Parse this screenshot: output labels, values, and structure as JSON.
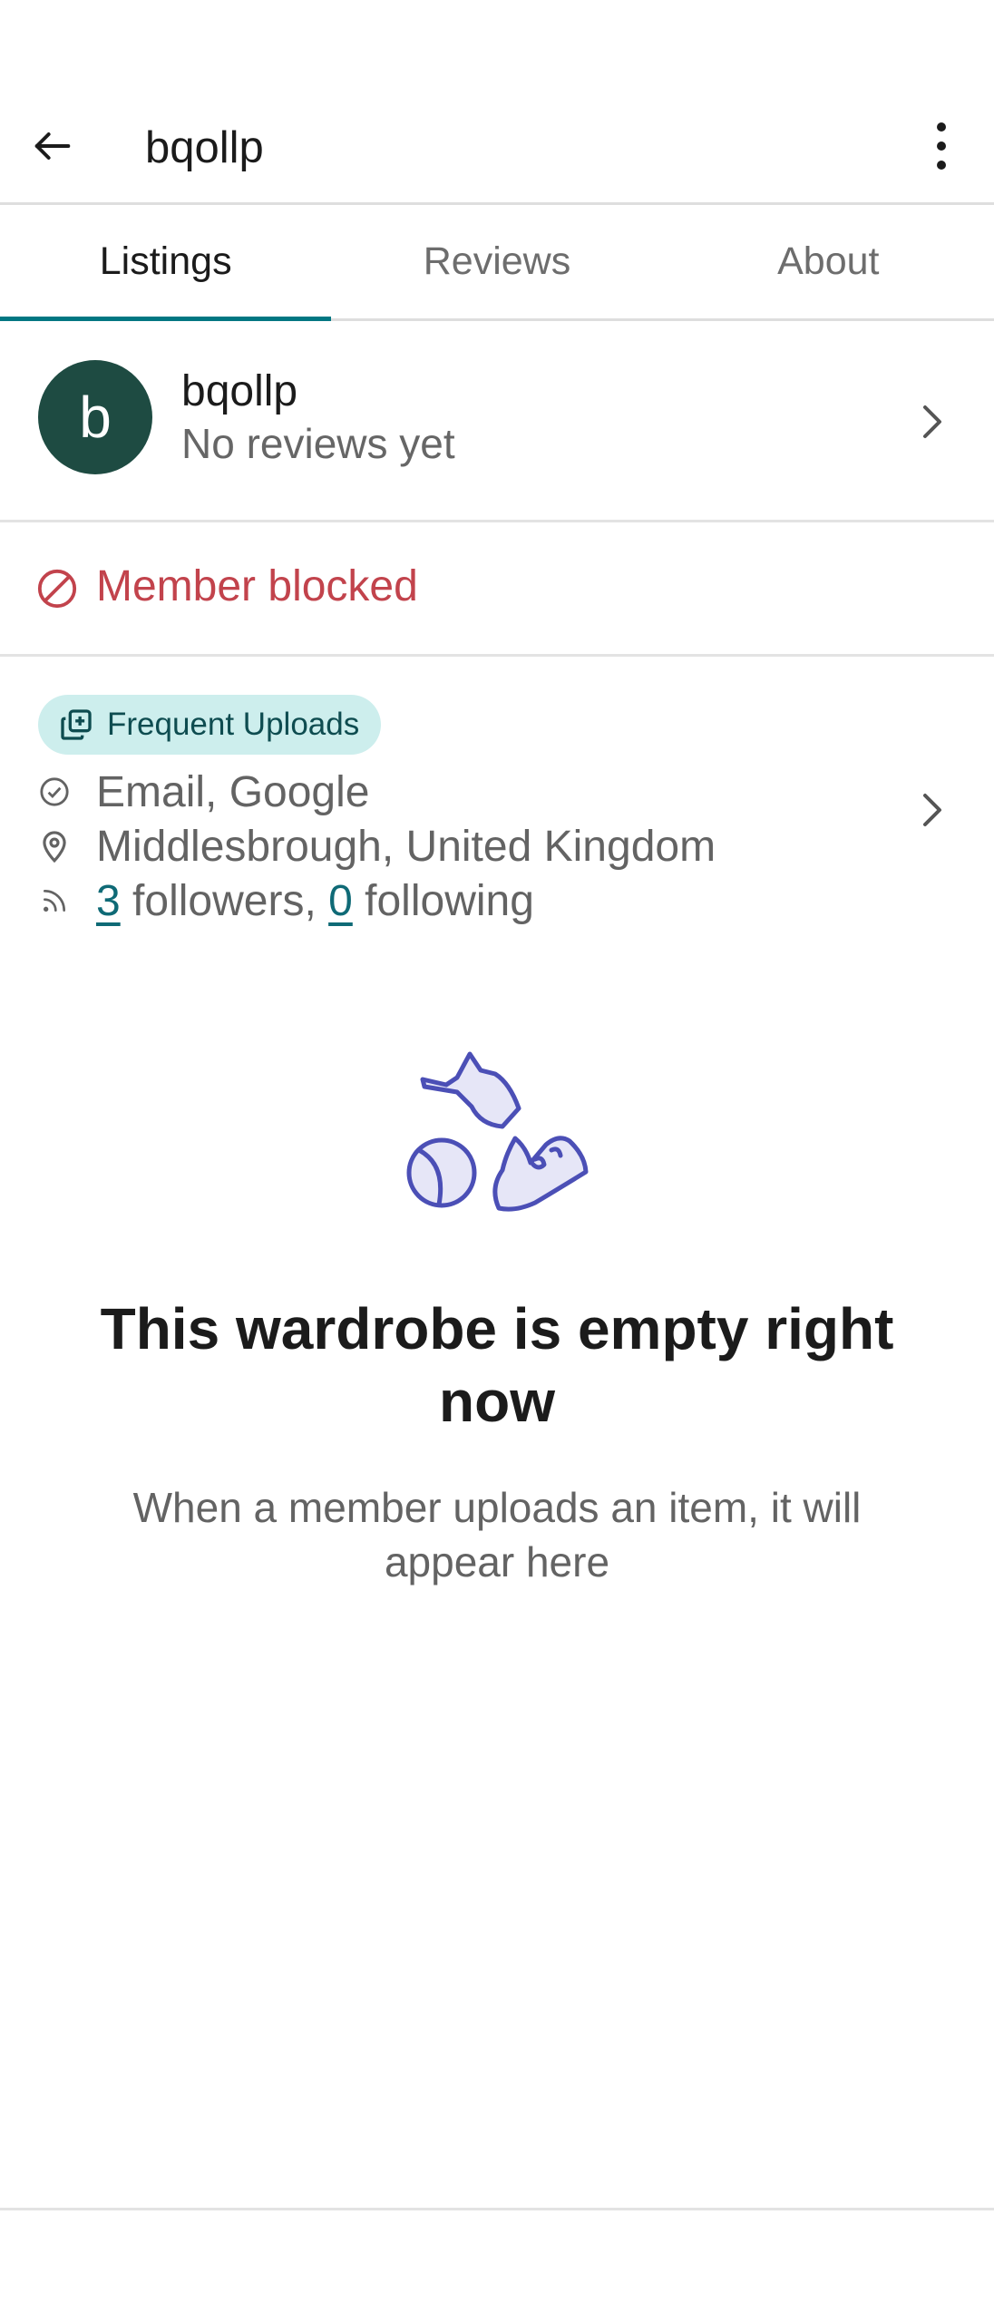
{
  "header": {
    "title": "bqollp",
    "back_icon": "arrow-left-icon",
    "more_icon": "more-vertical-icon"
  },
  "tabs": [
    {
      "label": "Listings",
      "active": true
    },
    {
      "label": "Reviews",
      "active": false
    },
    {
      "label": "About",
      "active": false
    }
  ],
  "profile": {
    "avatar_letter": "b",
    "avatar_color": "#1e4b42",
    "username": "bqollp",
    "reviews_text": "No reviews yet"
  },
  "blocked": {
    "text": "Member blocked",
    "color": "#c2434c"
  },
  "info": {
    "badge": "Frequent Uploads",
    "verified": "Email, Google",
    "location": "Middlesbrough, United Kingdom",
    "followers_count": "3",
    "followers_label": " followers, ",
    "following_count": "0",
    "following_label": " following"
  },
  "empty_state": {
    "title": "This wardrobe is empty right now",
    "description": "When a member uploads an item, it will appear here"
  },
  "colors": {
    "accent": "#007782",
    "badge_bg": "#cdeeed",
    "illustration": "#4b4fb6"
  }
}
